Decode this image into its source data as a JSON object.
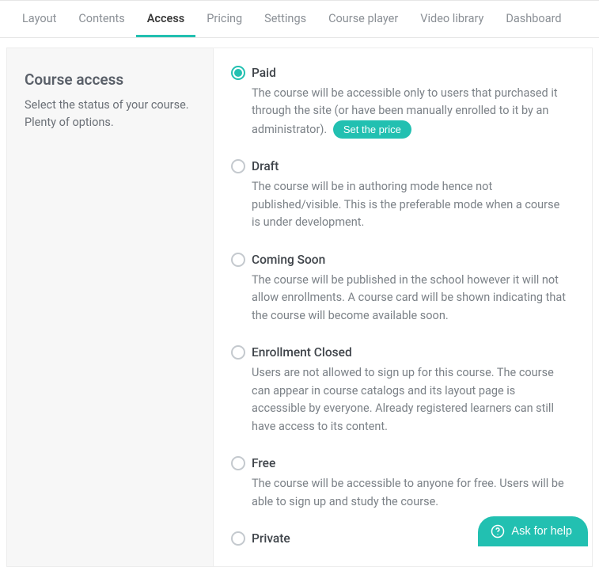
{
  "tabs": [
    {
      "label": "Layout",
      "active": false
    },
    {
      "label": "Contents",
      "active": false
    },
    {
      "label": "Access",
      "active": true
    },
    {
      "label": "Pricing",
      "active": false
    },
    {
      "label": "Settings",
      "active": false
    },
    {
      "label": "Course player",
      "active": false
    },
    {
      "label": "Video library",
      "active": false
    },
    {
      "label": "Dashboard",
      "active": false
    }
  ],
  "sidebar": {
    "title": "Course access",
    "subtitle": "Select the status of your course. Plenty of options."
  },
  "options": [
    {
      "key": "paid",
      "title": "Paid",
      "selected": true,
      "desc": "The course will be accessible only to users that purchased it through the site (or have been manually enrolled to it by an administrator).",
      "action_label": "Set the price"
    },
    {
      "key": "draft",
      "title": "Draft",
      "selected": false,
      "desc": "The course will be in authoring mode hence not published/visible. This is the preferable mode when a course is under development."
    },
    {
      "key": "coming-soon",
      "title": "Coming Soon",
      "selected": false,
      "desc": "The course will be published in the school however it will not allow enrollments. A course card will be shown indicating that the course will become available soon."
    },
    {
      "key": "enrollment-closed",
      "title": "Enrollment Closed",
      "selected": false,
      "desc": "Users are not allowed to sign up for this course. The course can appear in course catalogs and its layout page is accessible by everyone. Already registered learners can still have access to its content."
    },
    {
      "key": "free",
      "title": "Free",
      "selected": false,
      "desc": "The course will be accessible to anyone for free. Users will be able to sign up and study the course."
    },
    {
      "key": "private",
      "title": "Private",
      "selected": false,
      "desc": ""
    }
  ],
  "help": {
    "label": "Ask for help"
  },
  "colors": {
    "accent": "#22c0b1"
  }
}
